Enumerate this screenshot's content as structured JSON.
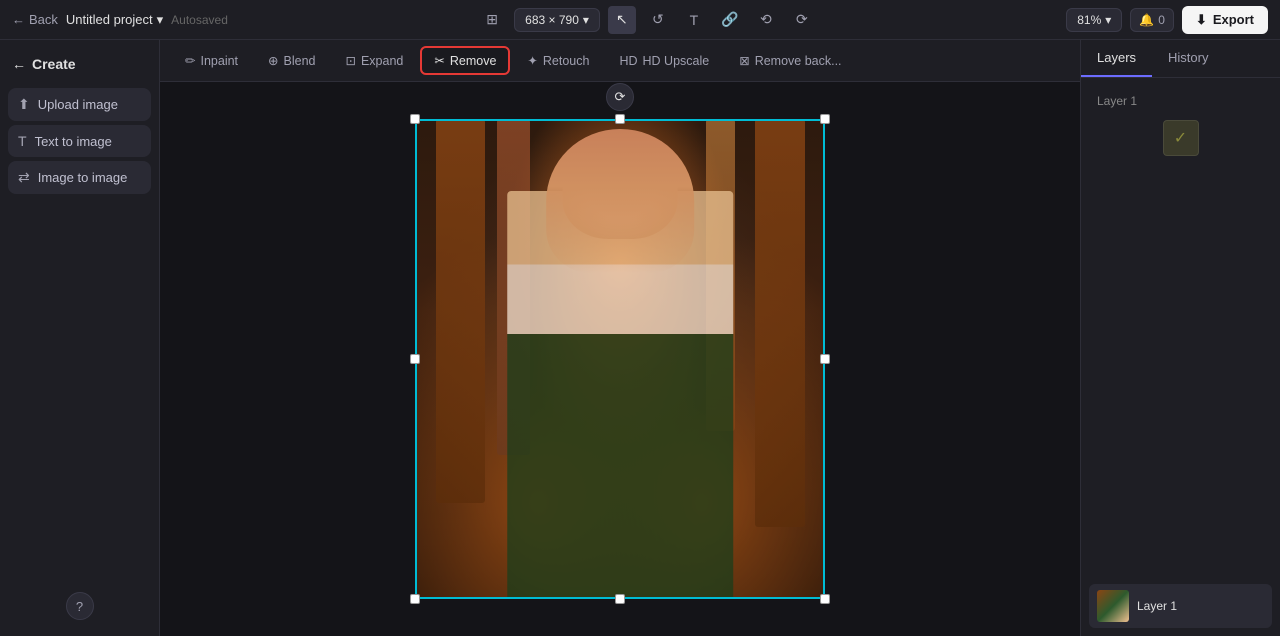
{
  "topbar": {
    "back_label": "Back",
    "project_name": "Untitled project",
    "autosaved_label": "Autosaved",
    "dimensions": "683 × 790",
    "zoom_level": "81%",
    "notif_count": "0",
    "export_label": "Export"
  },
  "sidebar": {
    "header_label": "Create",
    "items": [
      {
        "id": "upload-image",
        "label": "Upload image",
        "icon": "⬆"
      },
      {
        "id": "text-to-image",
        "label": "Text to image",
        "icon": "T"
      },
      {
        "id": "image-to-image",
        "label": "Image to image",
        "icon": "⇄"
      }
    ],
    "help_icon": "?"
  },
  "toolbar": {
    "tools": [
      {
        "id": "inpaint",
        "label": "Inpaint",
        "icon": "✏"
      },
      {
        "id": "blend",
        "label": "Blend",
        "icon": "⊕"
      },
      {
        "id": "expand",
        "label": "Expand",
        "icon": "⊡"
      },
      {
        "id": "remove",
        "label": "Remove",
        "icon": "✂",
        "active": true
      },
      {
        "id": "retouch",
        "label": "Retouch",
        "icon": "✦"
      },
      {
        "id": "hd-upscale",
        "label": "HD Upscale",
        "icon": "HD"
      },
      {
        "id": "remove-background",
        "label": "Remove back...",
        "icon": "⊠"
      }
    ]
  },
  "right_panel": {
    "tabs": [
      {
        "id": "layers",
        "label": "Layers",
        "active": true
      },
      {
        "id": "history",
        "label": "History",
        "active": false
      }
    ],
    "layer_name": "Layer 1",
    "layer_item_label": "Layer 1"
  }
}
